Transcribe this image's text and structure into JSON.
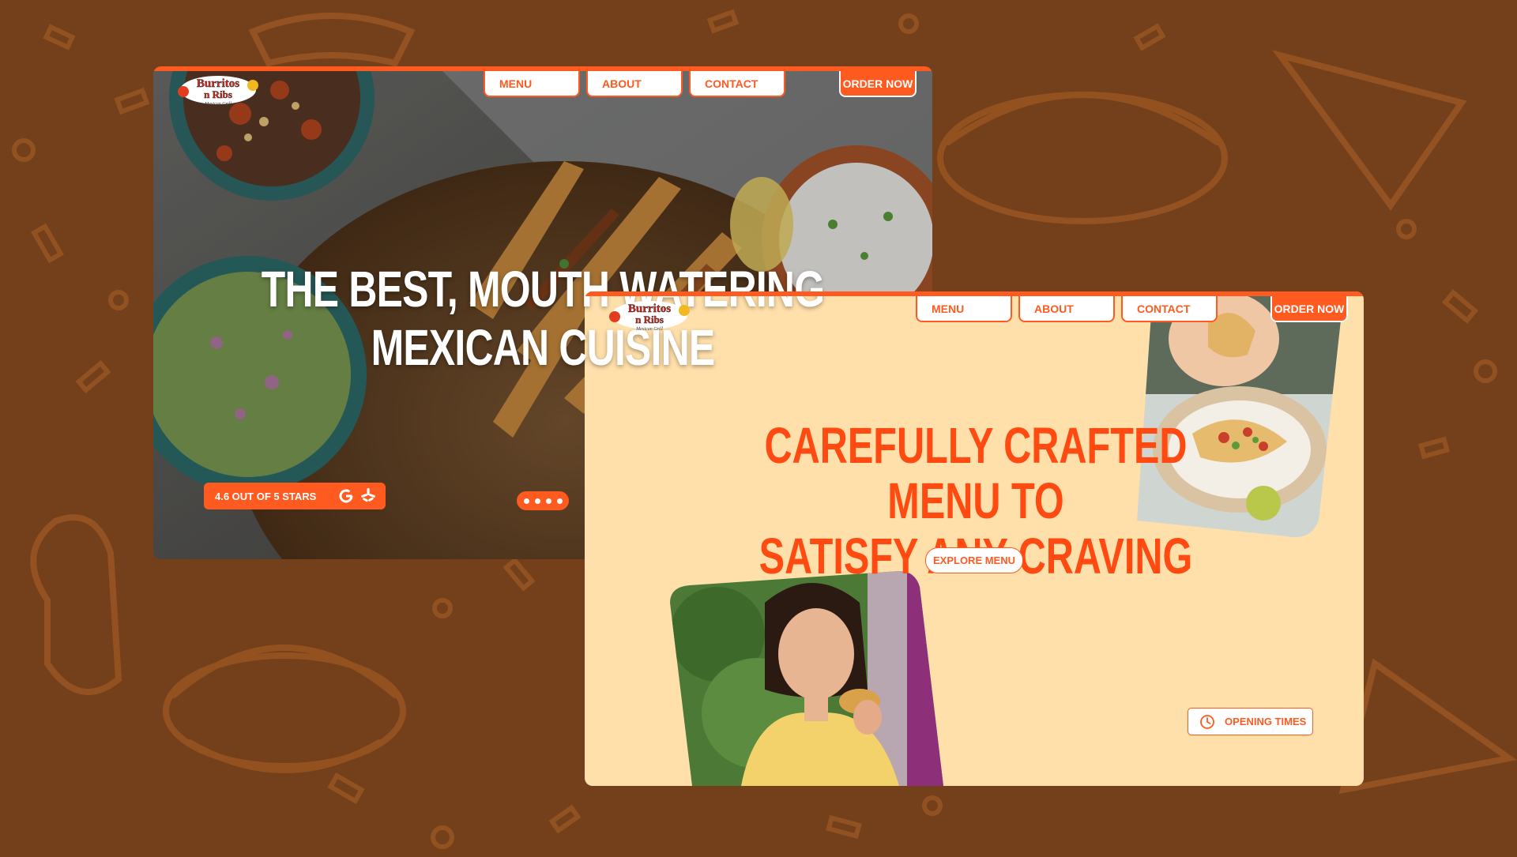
{
  "colors": {
    "background": "#74401b",
    "accent": "#ff5a1f",
    "cream": "#ffdfaa",
    "white": "#ffffff"
  },
  "mockup_dark": {
    "logo": {
      "line1": "Burritos",
      "line2": "n Ribs",
      "line3": "Mexican Grill"
    },
    "nav": {
      "menu": "MENU",
      "about": "ABOUT",
      "contact": "CONTACT",
      "order": "ORDER NOW"
    },
    "headline_line1": "THE BEST, MOUTH WATERING",
    "headline_line2": "MEXICAN CUISINE",
    "rating_text": "4.6 OUT OF 5 STARS",
    "icons": [
      "google-icon",
      "yelp-icon"
    ],
    "slider_dots": 4
  },
  "mockup_light": {
    "logo": {
      "line1": "Burritos",
      "line2": "n Ribs",
      "line3": "Mexican Grill"
    },
    "nav": {
      "menu": "MENU",
      "about": "ABOUT",
      "contact": "CONTACT",
      "order": "ORDER NOW"
    },
    "headline_line1": "CAREFULLY CRAFTED MENU TO",
    "headline_line2": "SATISFY ANY CRAVING",
    "explore_label": "EXPLORE MENU",
    "opening_label": "OPENING TIMES",
    "icons": [
      "clock-icon"
    ]
  }
}
